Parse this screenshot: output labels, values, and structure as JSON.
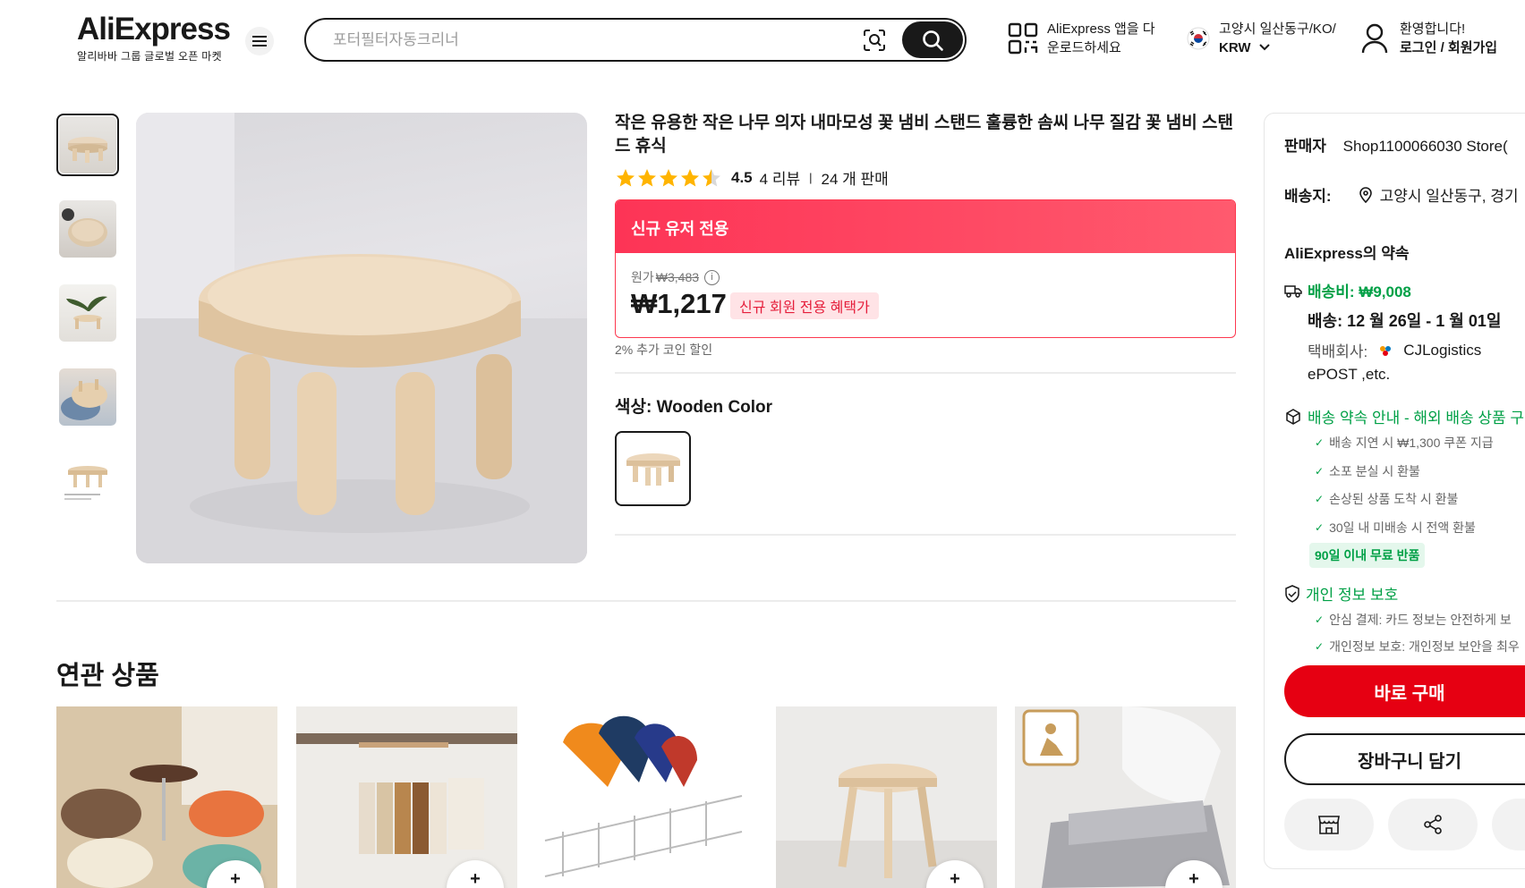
{
  "header": {
    "logo": "AliExpress",
    "logo_sub": "알리바바 그룹 글로벌 오픈 마켓",
    "search_placeholder": "포터필터자동크리너",
    "app_line1": "AliExpress 앱을 다",
    "app_line2": "운로드하세요",
    "region_line1": "고양시 일산동구/KO/",
    "region_currency": "KRW",
    "account_line1": "환영합니다!",
    "account_line2": "로그인 / 회원가입"
  },
  "product": {
    "title": "작은 유용한 작은 나무 의자 내마모성 꽃 냄비 스탠드 훌륭한 솜씨 나무 질감 꽃 냄비 스탠드 휴식",
    "rating": "4.5",
    "reviews": "4 리뷰",
    "sold": "24 개 판매",
    "banner": "신규 유저 전용",
    "orig_label": "원가",
    "orig_price": "₩3,483",
    "price": "₩1,217",
    "price_tag": "신규 회원 전용 혜택가",
    "coin_note": "2% 추가 코인 할인",
    "color_label": "색상:",
    "color_value": "Wooden Color"
  },
  "related": {
    "title": "연관 상품",
    "add_glyph": "+"
  },
  "side": {
    "seller_label": "판매자",
    "seller_name": "Shop1100066030 Store(",
    "ship_to_label": "배송지:",
    "ship_to_value": "고양시 일산동구, 경기",
    "promise_title": "AliExpress의 약속",
    "shipping_fee": "배송비: ₩9,008",
    "delivery": "배송: 12 월 26일 - 1 월 01일",
    "courier_label": "택배회사:",
    "courier_name": "CJLogistics",
    "courier_more": "ePOST ,etc.",
    "delivery_guarantee": "배송 약속 안내 - 해외 배송 상품 구",
    "guarantees": [
      "배송 지연 시 ₩1,300 쿠폰 지급",
      "소포 분실 시 환불",
      "손상된 상품 도착 시 환불",
      "30일 내 미배송 시 전액 환불"
    ],
    "free_return": "90일 이내 무료 반품",
    "privacy_title": "개인 정보 보호",
    "privacy_items": [
      "안심 결제: 카드 정보는 안전하게 보",
      "개인정보 보호: 개인정보 보안을 최우"
    ],
    "buy_now": "바로 구매",
    "add_to_cart": "장바구니 담기"
  },
  "colors": {
    "brand_red": "#e60012",
    "banner_red": "#fd3456",
    "green": "#00a046",
    "star": "#ffb400"
  }
}
